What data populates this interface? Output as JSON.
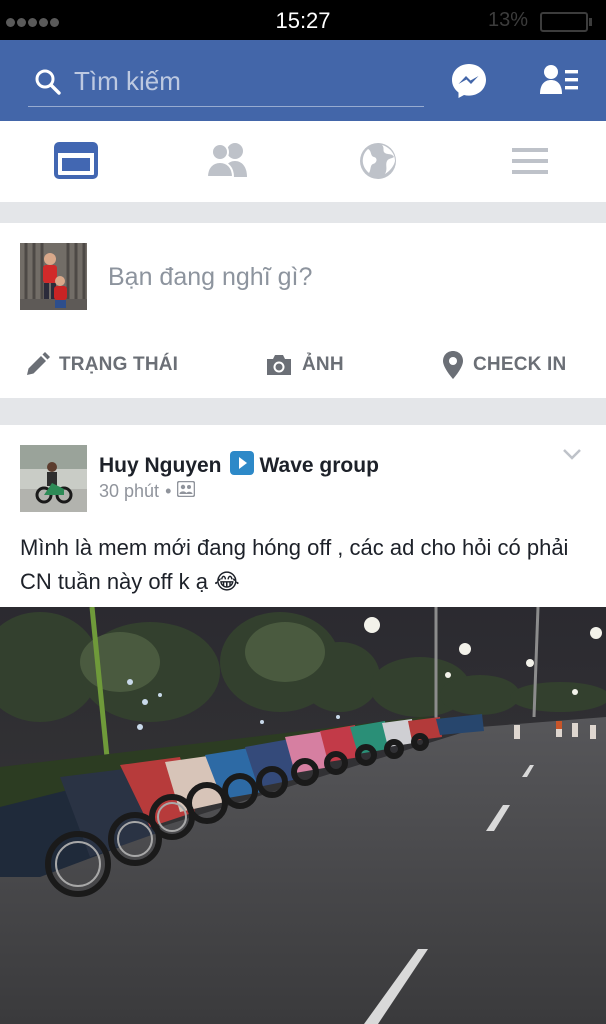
{
  "status_bar": {
    "time": "15:27",
    "battery_percent": "13%"
  },
  "header": {
    "search_placeholder": "Tìm kiếm"
  },
  "tabs": [
    {
      "name": "news-feed",
      "active": true
    },
    {
      "name": "friends",
      "active": false
    },
    {
      "name": "notifications",
      "active": false
    },
    {
      "name": "more",
      "active": false
    }
  ],
  "composer": {
    "prompt": "Bạn đang nghĩ gì?",
    "status_label": "TRẠNG THÁI",
    "photo_label": "ẢNH",
    "checkin_label": "CHECK IN"
  },
  "post": {
    "author": "Huy Nguyen",
    "group": "Wave group",
    "time": "30 phút",
    "text": "Mình là mem mới đang hóng off , các ad cho hỏi có phải CN tuần này off k ạ 😂"
  },
  "colors": {
    "brand_blue": "#4366a9",
    "active_tab": "#4267b2",
    "inactive_icon": "#bec2c9"
  }
}
